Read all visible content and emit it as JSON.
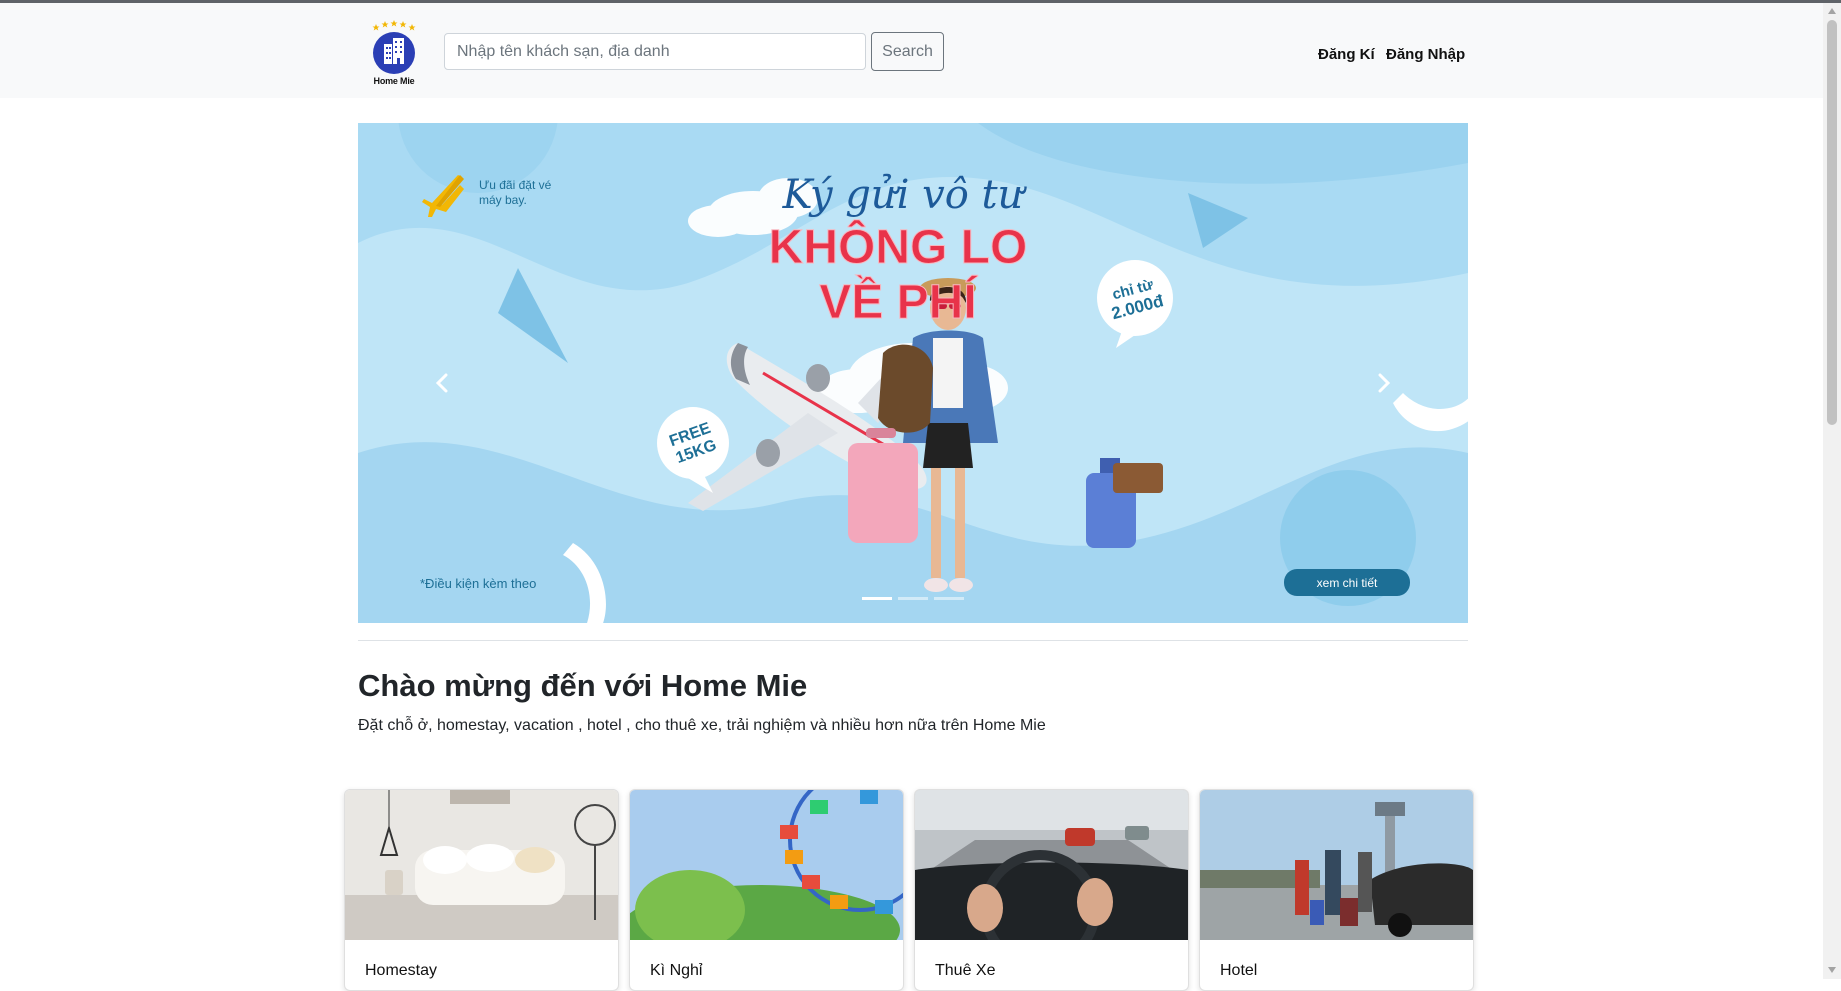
{
  "navbar": {
    "logo_text": "Home Mie",
    "search_placeholder": "Nhập tên khách sạn, địa danh",
    "search_value": "",
    "search_button": "Search",
    "links": [
      "Đăng Kí",
      "Đăng Nhập"
    ]
  },
  "banner": {
    "promo_label": "Ưu đãi đặt vé máy bay.",
    "script_headline": "Ký gửi vô tư",
    "headline_line1": "KHÔNG LO",
    "headline_line2": "VỀ PHÍ",
    "badge_price_line1": "chỉ từ",
    "badge_price_line2": "2.000đ",
    "badge_free_line1": "FREE",
    "badge_free_line2": "15KG",
    "condition": "*Điều kiện kèm theo",
    "cta": "xem chi tiết",
    "slides": 3,
    "active_slide": 1
  },
  "welcome": {
    "title": "Chào mừng đến với Home Mie",
    "subtitle": "Đặt chỗ ở, homestay, vacation , hotel , cho thuê xe, trải nghiệm và nhiều hơn nữa trên Home Mie"
  },
  "cards": [
    {
      "title": "Homestay",
      "image": "living-room-image"
    },
    {
      "title": "Kì Nghỉ",
      "image": "ferris-wheel-image"
    },
    {
      "title": "Thuê Xe",
      "image": "car-driving-image"
    },
    {
      "title": "Hotel",
      "image": "airport-taxi-image"
    }
  ],
  "colors": {
    "banner_bg": "#bfe5f7",
    "headline_red": "#e8334a",
    "brand_blue": "#2b3fb5",
    "cta_teal": "#1d6f96"
  }
}
